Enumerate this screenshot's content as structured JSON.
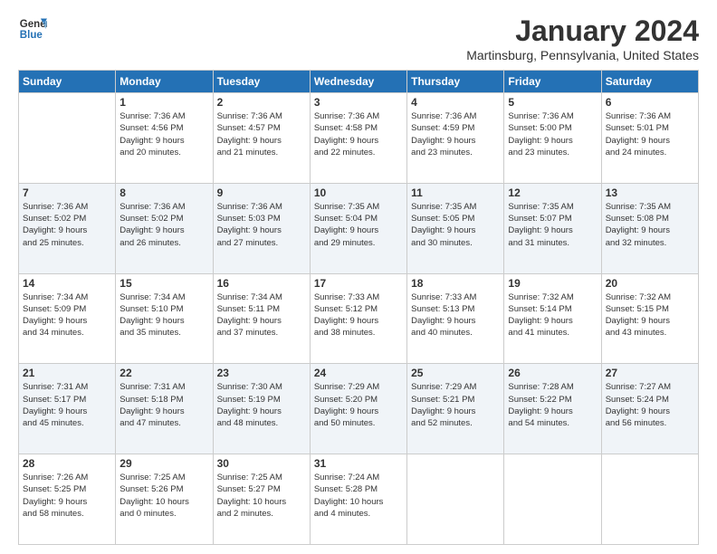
{
  "logo": {
    "line1": "General",
    "line2": "Blue"
  },
  "header": {
    "month": "January 2024",
    "location": "Martinsburg, Pennsylvania, United States"
  },
  "weekdays": [
    "Sunday",
    "Monday",
    "Tuesday",
    "Wednesday",
    "Thursday",
    "Friday",
    "Saturday"
  ],
  "weeks": [
    [
      {
        "day": "",
        "info": ""
      },
      {
        "day": "1",
        "info": "Sunrise: 7:36 AM\nSunset: 4:56 PM\nDaylight: 9 hours\nand 20 minutes."
      },
      {
        "day": "2",
        "info": "Sunrise: 7:36 AM\nSunset: 4:57 PM\nDaylight: 9 hours\nand 21 minutes."
      },
      {
        "day": "3",
        "info": "Sunrise: 7:36 AM\nSunset: 4:58 PM\nDaylight: 9 hours\nand 22 minutes."
      },
      {
        "day": "4",
        "info": "Sunrise: 7:36 AM\nSunset: 4:59 PM\nDaylight: 9 hours\nand 23 minutes."
      },
      {
        "day": "5",
        "info": "Sunrise: 7:36 AM\nSunset: 5:00 PM\nDaylight: 9 hours\nand 23 minutes."
      },
      {
        "day": "6",
        "info": "Sunrise: 7:36 AM\nSunset: 5:01 PM\nDaylight: 9 hours\nand 24 minutes."
      }
    ],
    [
      {
        "day": "7",
        "info": "Sunrise: 7:36 AM\nSunset: 5:02 PM\nDaylight: 9 hours\nand 25 minutes."
      },
      {
        "day": "8",
        "info": "Sunrise: 7:36 AM\nSunset: 5:02 PM\nDaylight: 9 hours\nand 26 minutes."
      },
      {
        "day": "9",
        "info": "Sunrise: 7:36 AM\nSunset: 5:03 PM\nDaylight: 9 hours\nand 27 minutes."
      },
      {
        "day": "10",
        "info": "Sunrise: 7:35 AM\nSunset: 5:04 PM\nDaylight: 9 hours\nand 29 minutes."
      },
      {
        "day": "11",
        "info": "Sunrise: 7:35 AM\nSunset: 5:05 PM\nDaylight: 9 hours\nand 30 minutes."
      },
      {
        "day": "12",
        "info": "Sunrise: 7:35 AM\nSunset: 5:07 PM\nDaylight: 9 hours\nand 31 minutes."
      },
      {
        "day": "13",
        "info": "Sunrise: 7:35 AM\nSunset: 5:08 PM\nDaylight: 9 hours\nand 32 minutes."
      }
    ],
    [
      {
        "day": "14",
        "info": "Sunrise: 7:34 AM\nSunset: 5:09 PM\nDaylight: 9 hours\nand 34 minutes."
      },
      {
        "day": "15",
        "info": "Sunrise: 7:34 AM\nSunset: 5:10 PM\nDaylight: 9 hours\nand 35 minutes."
      },
      {
        "day": "16",
        "info": "Sunrise: 7:34 AM\nSunset: 5:11 PM\nDaylight: 9 hours\nand 37 minutes."
      },
      {
        "day": "17",
        "info": "Sunrise: 7:33 AM\nSunset: 5:12 PM\nDaylight: 9 hours\nand 38 minutes."
      },
      {
        "day": "18",
        "info": "Sunrise: 7:33 AM\nSunset: 5:13 PM\nDaylight: 9 hours\nand 40 minutes."
      },
      {
        "day": "19",
        "info": "Sunrise: 7:32 AM\nSunset: 5:14 PM\nDaylight: 9 hours\nand 41 minutes."
      },
      {
        "day": "20",
        "info": "Sunrise: 7:32 AM\nSunset: 5:15 PM\nDaylight: 9 hours\nand 43 minutes."
      }
    ],
    [
      {
        "day": "21",
        "info": "Sunrise: 7:31 AM\nSunset: 5:17 PM\nDaylight: 9 hours\nand 45 minutes."
      },
      {
        "day": "22",
        "info": "Sunrise: 7:31 AM\nSunset: 5:18 PM\nDaylight: 9 hours\nand 47 minutes."
      },
      {
        "day": "23",
        "info": "Sunrise: 7:30 AM\nSunset: 5:19 PM\nDaylight: 9 hours\nand 48 minutes."
      },
      {
        "day": "24",
        "info": "Sunrise: 7:29 AM\nSunset: 5:20 PM\nDaylight: 9 hours\nand 50 minutes."
      },
      {
        "day": "25",
        "info": "Sunrise: 7:29 AM\nSunset: 5:21 PM\nDaylight: 9 hours\nand 52 minutes."
      },
      {
        "day": "26",
        "info": "Sunrise: 7:28 AM\nSunset: 5:22 PM\nDaylight: 9 hours\nand 54 minutes."
      },
      {
        "day": "27",
        "info": "Sunrise: 7:27 AM\nSunset: 5:24 PM\nDaylight: 9 hours\nand 56 minutes."
      }
    ],
    [
      {
        "day": "28",
        "info": "Sunrise: 7:26 AM\nSunset: 5:25 PM\nDaylight: 9 hours\nand 58 minutes."
      },
      {
        "day": "29",
        "info": "Sunrise: 7:25 AM\nSunset: 5:26 PM\nDaylight: 10 hours\nand 0 minutes."
      },
      {
        "day": "30",
        "info": "Sunrise: 7:25 AM\nSunset: 5:27 PM\nDaylight: 10 hours\nand 2 minutes."
      },
      {
        "day": "31",
        "info": "Sunrise: 7:24 AM\nSunset: 5:28 PM\nDaylight: 10 hours\nand 4 minutes."
      },
      {
        "day": "",
        "info": ""
      },
      {
        "day": "",
        "info": ""
      },
      {
        "day": "",
        "info": ""
      }
    ]
  ]
}
